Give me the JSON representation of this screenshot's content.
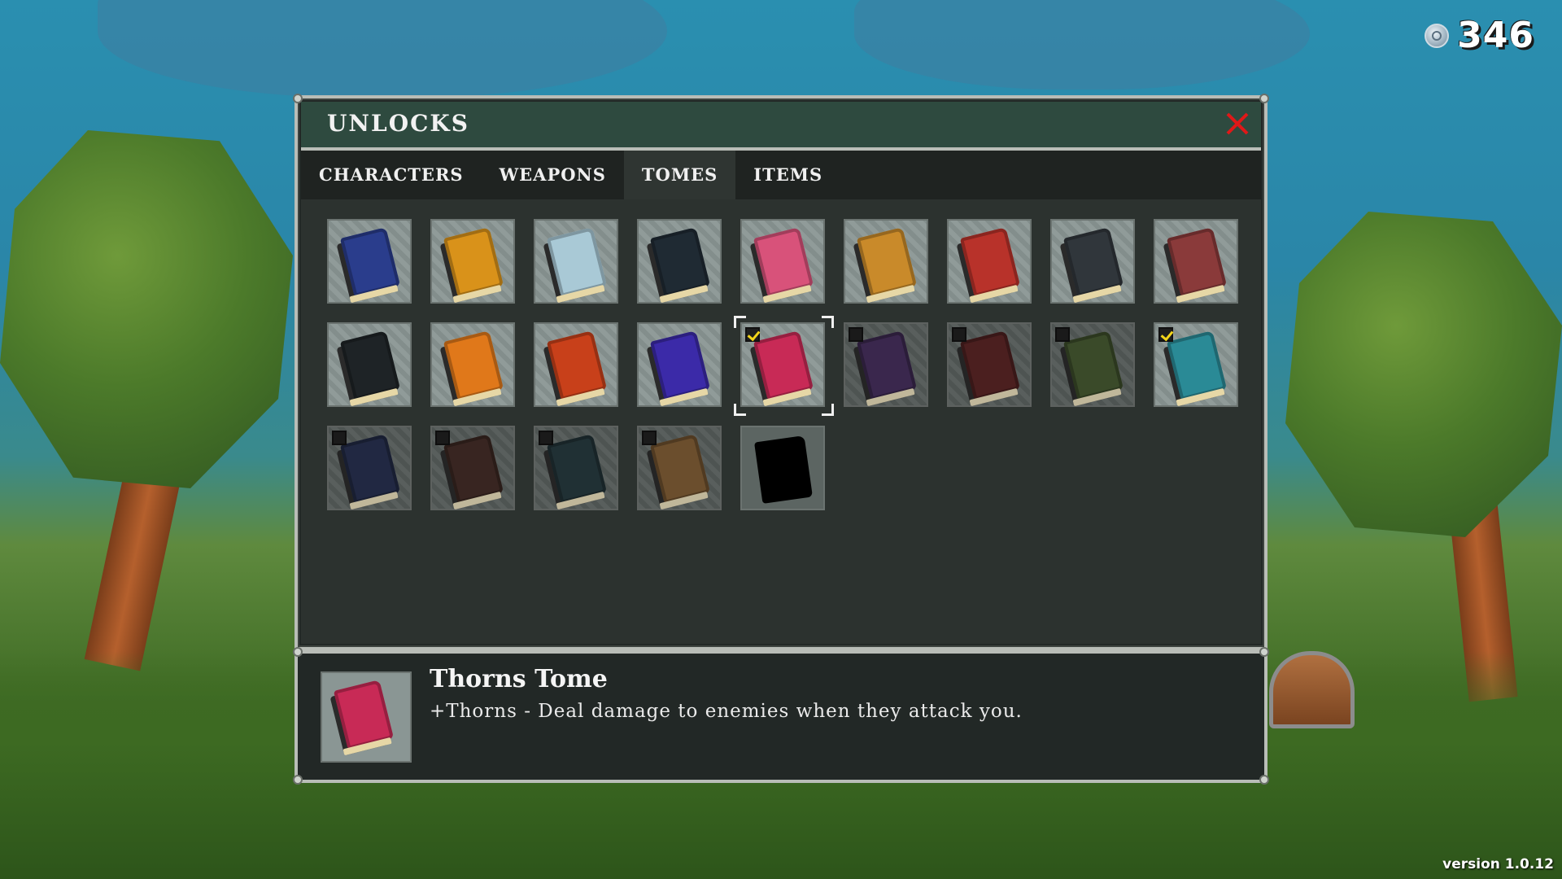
{
  "hud": {
    "currency": "346",
    "currency_icon": "silver-coin-icon",
    "version": "version 1.0.12"
  },
  "window": {
    "title": "UNLOCKS"
  },
  "tabs": [
    {
      "label": "CHARACTERS",
      "active": false
    },
    {
      "label": "WEAPONS",
      "active": false
    },
    {
      "label": "TOMES",
      "active": true
    },
    {
      "label": "ITEMS",
      "active": false
    }
  ],
  "tomes": [
    {
      "icon": "blue-arrow-tome-icon",
      "color": "#2a3d8c",
      "state": "unlocked"
    },
    {
      "icon": "gold-tome-icon",
      "color": "#d9921a",
      "state": "unlocked"
    },
    {
      "icon": "ice-tome-icon",
      "color": "#a9c9d6",
      "state": "unlocked"
    },
    {
      "icon": "eye-tome-icon",
      "color": "#1f2a33",
      "state": "unlocked"
    },
    {
      "icon": "pink-tome-icon",
      "color": "#d8527a",
      "state": "unlocked"
    },
    {
      "icon": "golden-rune-tome-icon",
      "color": "#c98a2a",
      "state": "unlocked"
    },
    {
      "icon": "red-claw-tome-icon",
      "color": "#b8322a",
      "state": "unlocked"
    },
    {
      "icon": "serpent-tome-icon",
      "color": "#30363b",
      "state": "unlocked"
    },
    {
      "icon": "heart-tome-icon",
      "color": "#8a3a3a",
      "state": "unlocked"
    },
    {
      "icon": "black-tome-icon",
      "color": "#1e2326",
      "state": "unlocked"
    },
    {
      "icon": "orange-glyph-tome-icon",
      "color": "#e0781a",
      "state": "unlocked"
    },
    {
      "icon": "fire-tome-icon",
      "color": "#c8401a",
      "state": "unlocked"
    },
    {
      "icon": "arcane-tome-icon",
      "color": "#3b2aa8",
      "state": "unlocked"
    },
    {
      "icon": "thorns-tome-icon",
      "color": "#c82a56",
      "state": "checked",
      "selected": true
    },
    {
      "icon": "purple-spiral-tome-icon",
      "color": "#4a2a6a",
      "state": "locked"
    },
    {
      "icon": "blood-tome-icon",
      "color": "#6a2020",
      "state": "locked"
    },
    {
      "icon": "nature-tome-icon",
      "color": "#3f5a22",
      "state": "locked"
    },
    {
      "icon": "teal-tome-icon",
      "color": "#2a8a96",
      "state": "checked"
    },
    {
      "icon": "night-tome-icon",
      "color": "#232f5a",
      "state": "locked"
    },
    {
      "icon": "leaf-tome-icon",
      "color": "#4a2a22",
      "state": "locked"
    },
    {
      "icon": "crystal-tome-icon",
      "color": "#1f3a40",
      "state": "locked"
    },
    {
      "icon": "tiki-tome-icon",
      "color": "#8a5a22",
      "state": "locked"
    },
    {
      "icon": "hidden-tome-icon",
      "color": "#000000",
      "state": "hidden"
    }
  ],
  "selected_tome": {
    "name": "Thorns Tome",
    "description": "+Thorns - Deal damage to enemies when they attack you.",
    "icon": "thorns-tome-icon",
    "color": "#c82a56"
  }
}
